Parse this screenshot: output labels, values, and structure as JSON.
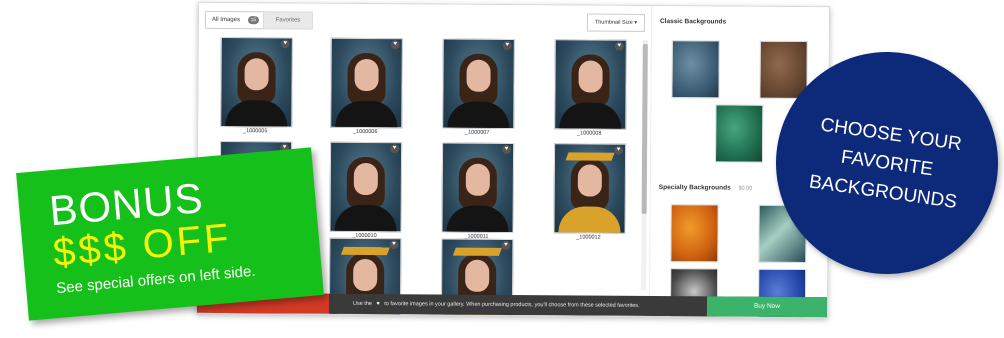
{
  "toolbar": {
    "all_images_label": "All Images",
    "all_images_count": "15",
    "favorites_label": "Favorites",
    "thumbnail_size_label": "Thumbnail Size ▾"
  },
  "gallery": {
    "images": [
      {
        "caption": "_1000005",
        "style": "plain"
      },
      {
        "caption": "_1000006",
        "style": "plain"
      },
      {
        "caption": "_1000007",
        "style": "plain"
      },
      {
        "caption": "_1000008",
        "style": "plain"
      },
      {
        "caption": "",
        "style": "plain"
      },
      {
        "caption": "_1000010",
        "style": "plain"
      },
      {
        "caption": "_1000011",
        "style": "plain"
      },
      {
        "caption": "_1000012",
        "style": "gown"
      },
      {
        "caption": "",
        "style": "gown"
      },
      {
        "caption": "",
        "style": "gown"
      },
      {
        "caption": "",
        "style": "gown"
      }
    ]
  },
  "backgrounds": {
    "classic_title": "Classic Backgrounds",
    "specialty_title": "Specialty Backgrounds",
    "specialty_price": "$0.00",
    "classic": [
      "blue",
      "rust",
      "green"
    ],
    "specialty": [
      "orange",
      "teal",
      "spot",
      "royal"
    ]
  },
  "footer": {
    "message_before": "Use the",
    "heart_icon": "♥",
    "message_after": "to favorite images in your gallery. When purchasing products, you'll choose from these selected favorites.",
    "buy_label": "Buy Now"
  },
  "promo": {
    "bonus_title": "BONUS",
    "bonus_off": "$$$ OFF",
    "bonus_sub": "See special offers on left side.",
    "callout": "CHOOSE YOUR FAVORITE BACKGROUNDS"
  },
  "colors": {
    "bonus_green": "#16c01a",
    "bonus_yellow": "#f4f40a",
    "callout_navy": "#0d2a7a",
    "buy_green": "#3bb36a",
    "footer_red": "#d23a26"
  }
}
